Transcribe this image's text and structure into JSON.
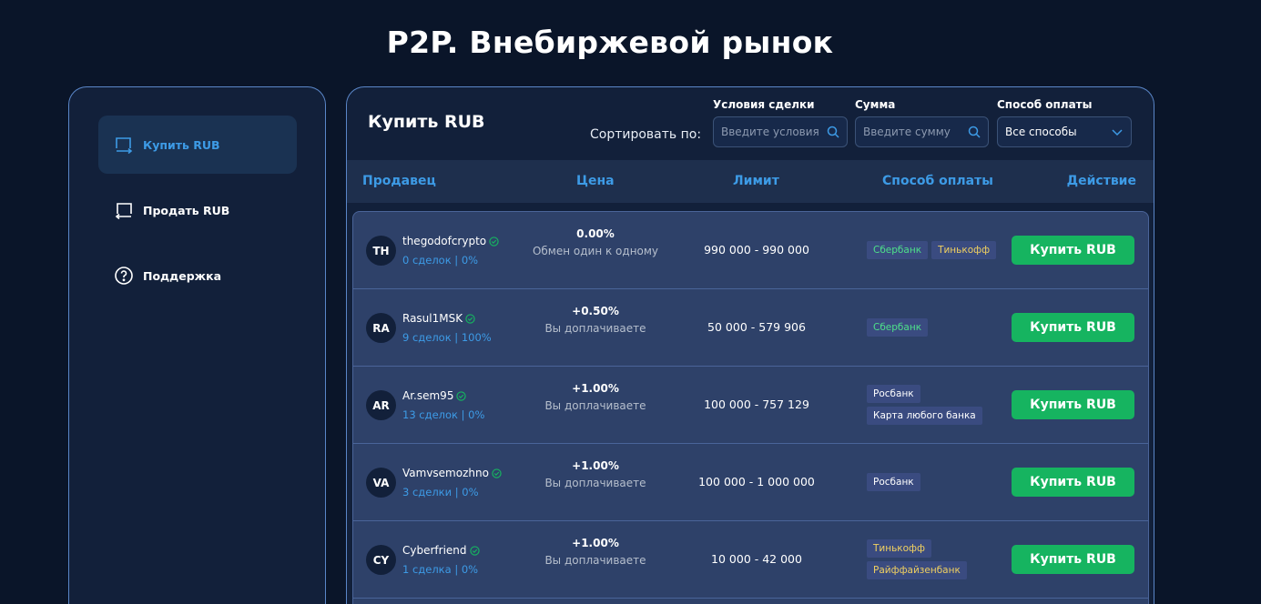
{
  "page_title": "P2P. Внебиржевой рынок",
  "sidebar": {
    "items": [
      {
        "label": "Купить RUB",
        "active": true
      },
      {
        "label": "Продать RUB"
      },
      {
        "label": "Поддержка"
      }
    ]
  },
  "main": {
    "title": "Купить RUB",
    "sort_label": "Сортировать по:",
    "filters": {
      "conditions": {
        "label": "Условия сделки",
        "placeholder": "Введите условия"
      },
      "amount": {
        "label": "Сумма",
        "placeholder": "Введите сумму"
      },
      "payment": {
        "label": "Способ оплаты",
        "value": "Все способы"
      }
    },
    "columns": [
      "Продавец",
      "Цена",
      "Лимит",
      "Способ оплаты",
      "Действие"
    ],
    "colors": {
      "green": "#4ee08a",
      "yellow": "#f0d060",
      "white": "#ffffff",
      "accent": "#3d9be6",
      "button": "#16b460"
    },
    "rows": [
      {
        "initials": "TH",
        "name": "thegodofcrypto",
        "stats": "0 сделок | 0%",
        "pct": "0.00%",
        "note": "Обмен один к одному",
        "limit": "990 000 - 990 000",
        "tags": [
          {
            "label": "Сбербанк",
            "color": "green"
          },
          {
            "label": "Тинькофф",
            "color": "yellow"
          }
        ],
        "button": "Купить RUB"
      },
      {
        "initials": "RA",
        "name": "Rasul1MSK",
        "stats": "9 сделок | 100%",
        "pct": "+0.50%",
        "note": "Вы доплачиваете",
        "limit": "50 000 - 579 906",
        "tags": [
          {
            "label": "Сбербанк",
            "color": "green"
          }
        ],
        "button": "Купить RUB"
      },
      {
        "initials": "AR",
        "name": "Ar.sem95",
        "stats": "13 сделок | 0%",
        "pct": "+1.00%",
        "note": "Вы доплачиваете",
        "limit": "100 000 - 757 129",
        "tags": [
          {
            "label": "Росбанк",
            "color": "white"
          },
          {
            "label": "Карта любого банка",
            "color": "white"
          }
        ],
        "button": "Купить RUB"
      },
      {
        "initials": "VA",
        "name": "Vamvsemozhno",
        "stats": "3 сделки | 0%",
        "pct": "+1.00%",
        "note": "Вы доплачиваете",
        "limit": "100 000 - 1 000 000",
        "tags": [
          {
            "label": "Росбанк",
            "color": "white"
          }
        ],
        "button": "Купить RUB"
      },
      {
        "initials": "CY",
        "name": "Cyberfriend",
        "stats": "1 сделка | 0%",
        "pct": "+1.00%",
        "note": "Вы доплачиваете",
        "limit": "10 000 - 42 000",
        "tags": [
          {
            "label": "Тинькофф",
            "color": "yellow"
          },
          {
            "label": "Райффайзенбанк",
            "color": "yellow"
          }
        ],
        "button": "Купить RUB"
      }
    ]
  }
}
